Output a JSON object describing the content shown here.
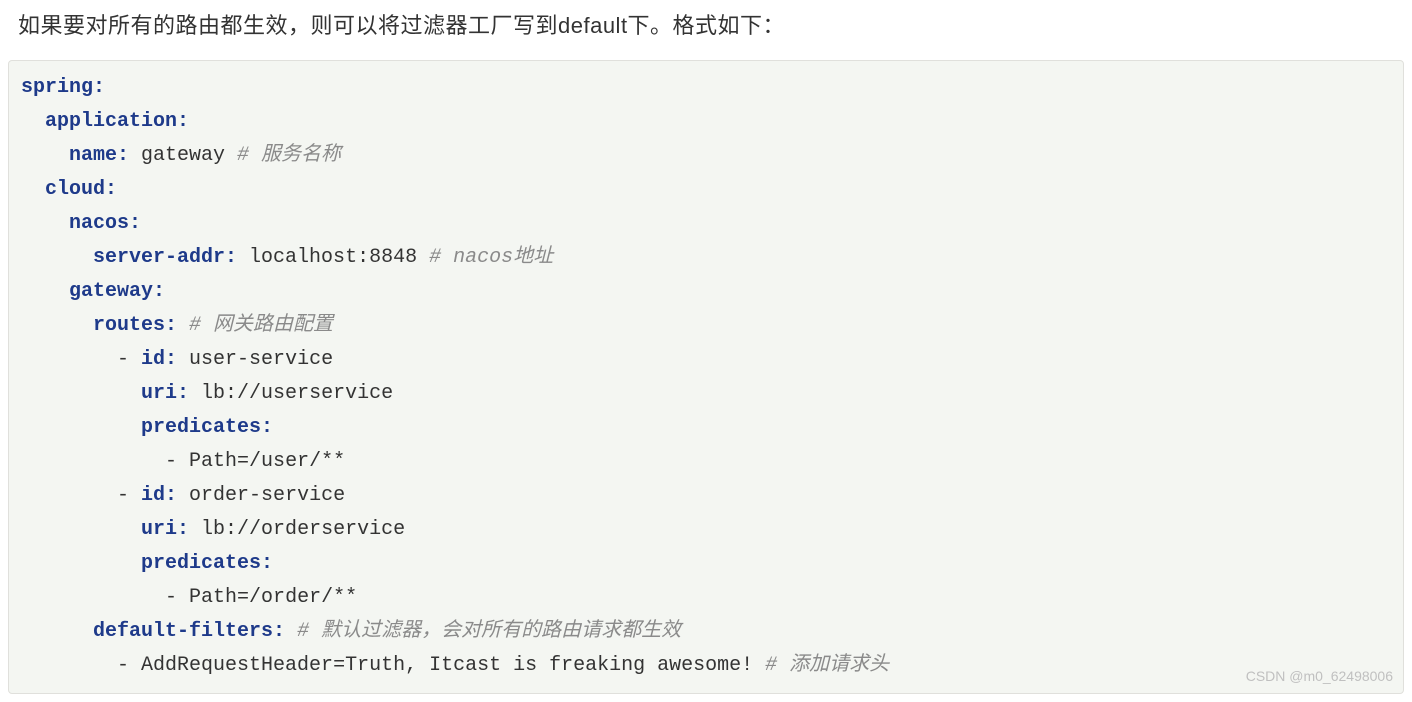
{
  "intro": "如果要对所有的路由都生效，则可以将过滤器工厂写到default下。格式如下：",
  "code": {
    "l1_key": "spring:",
    "l2_key": "application:",
    "l3_key": "name: ",
    "l3_val": "gateway ",
    "l3_comment": "# 服务名称",
    "l4_key": "cloud:",
    "l5_key": "nacos:",
    "l6_key": "server-addr: ",
    "l6_val": "localhost:8848 ",
    "l6_comment": "# nacos地址",
    "l7_key": "gateway:",
    "l8_key": "routes: ",
    "l8_comment": "# 网关路由配置",
    "l9_dash": "- ",
    "l9_key": "id: ",
    "l9_val": "user-service",
    "l10_key": "uri: ",
    "l10_val": "lb://userservice",
    "l11_key": "predicates:",
    "l12_dash": "- ",
    "l12_val": "Path=/user/**",
    "l13_dash": "- ",
    "l13_key": "id: ",
    "l13_val": "order-service",
    "l14_key": "uri: ",
    "l14_val": "lb://orderservice",
    "l15_key": "predicates:",
    "l16_dash": "- ",
    "l16_val": "Path=/order/**",
    "l17_key": "default-filters: ",
    "l17_comment": "# 默认过滤器，会对所有的路由请求都生效",
    "l18_dash": "- ",
    "l18_val": "AddRequestHeader=Truth, Itcast is freaking awesome! ",
    "l18_comment": "# 添加请求头"
  },
  "watermark": "CSDN @m0_62498006"
}
